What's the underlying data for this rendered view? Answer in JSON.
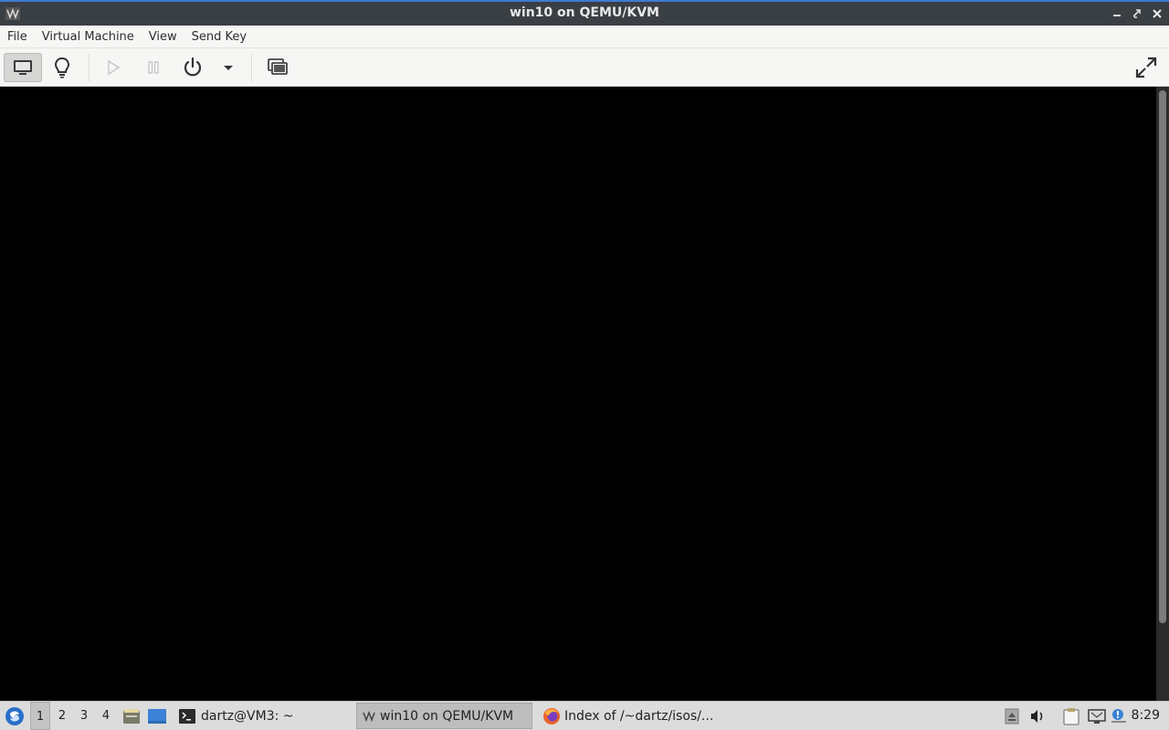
{
  "window": {
    "title": "win10 on QEMU/KVM"
  },
  "menu": [
    "File",
    "Virtual Machine",
    "View",
    "Send Key"
  ],
  "toolbar": {
    "buttons": [
      {
        "name": "console",
        "icon": "monitor-icon",
        "active": true
      },
      {
        "name": "details",
        "icon": "lightbulb-icon",
        "active": false
      },
      {
        "name": "run",
        "icon": "play-icon",
        "active": false,
        "disabled": true
      },
      {
        "name": "pause",
        "icon": "pause-icon",
        "active": false,
        "disabled": true
      },
      {
        "name": "shutdown",
        "icon": "power-icon",
        "active": false
      },
      {
        "name": "shutdown-menu",
        "icon": "chevron-down-icon",
        "active": false
      },
      {
        "name": "snapshots",
        "icon": "snapshots-icon",
        "active": false
      },
      {
        "name": "fullscreen",
        "icon": "fullscreen-icon",
        "active": false
      }
    ]
  },
  "taskbar": {
    "workspaces": [
      "1",
      "2",
      "3",
      "4"
    ],
    "active_workspace": "1",
    "tasks": [
      {
        "label": "dartz@VM3: ~",
        "icon": "terminal-icon",
        "active": false
      },
      {
        "label": "win10 on QEMU/KVM",
        "icon": "virt-manager-icon",
        "active": true
      },
      {
        "label": "Index of /~dartz/isos/...",
        "icon": "firefox-icon",
        "active": false
      }
    ],
    "clock": "8:29"
  },
  "colors": {
    "titlebar": "#3a3f44",
    "accent": "#3c7bd4",
    "display": "#000000",
    "taskbar": "#dcdcdc"
  }
}
